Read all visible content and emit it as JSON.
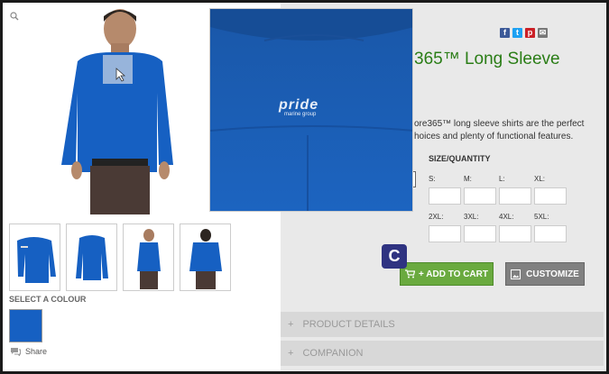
{
  "product": {
    "title_fragment": "365™ Long Sleeve",
    "description_line1": "ore365™ long sleeve shirts are the perfect",
    "description_line2": "hoices and plenty of functional features."
  },
  "gallery": {
    "zoom_logo_text": "pride",
    "zoom_logo_sub": "marine group",
    "colour_label": "SELECT A COLOUR",
    "share_label": "Share"
  },
  "sizes": {
    "heading": "SIZE/QUANTITY",
    "labels": [
      "S:",
      "M:",
      "L:",
      "XL:",
      "2XL:",
      "3XL:",
      "4XL:",
      "5XL:"
    ]
  },
  "badge": {
    "letter": "C"
  },
  "buttons": {
    "add_to_cart": "+ ADD TO CART",
    "customize": "CUSTOMIZE"
  },
  "accordion": {
    "product_details": "PRODUCT DETAILS",
    "companion": "COMPANION",
    "plus": "+"
  },
  "colors": {
    "title_green": "#2a7d16",
    "cart_green": "#6aaa3f",
    "shirt_blue": "#1660c2",
    "badge_navy": "#2f3381"
  }
}
